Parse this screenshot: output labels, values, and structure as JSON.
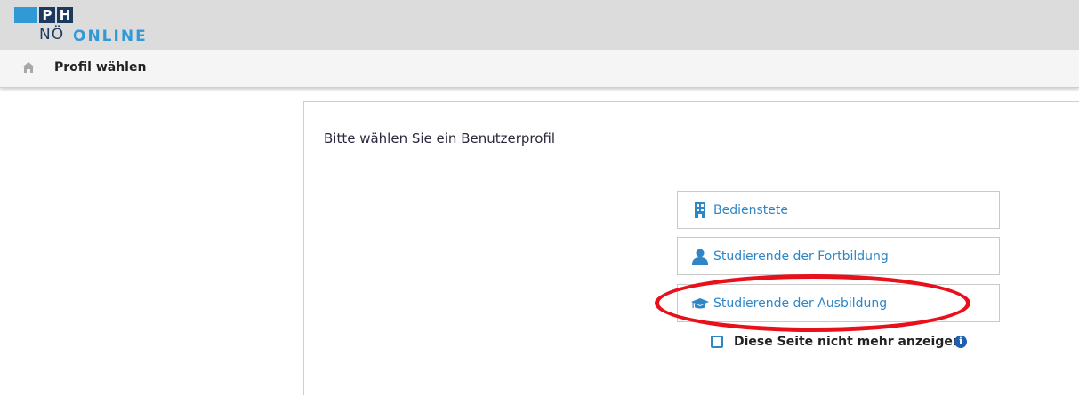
{
  "header": {
    "logo": {
      "letters_top": [
        "P",
        "H"
      ],
      "letters_bottom": "NÖ",
      "brand": "ONLINE"
    },
    "colors": {
      "brand_dark": "#1d3a5e",
      "brand_blue": "#2f9ad6"
    }
  },
  "breadcrumb": {
    "home_icon": "home-icon",
    "label": "Profil wählen"
  },
  "main": {
    "heading": "Bitte wählen Sie ein Benutzerprofil",
    "profiles": [
      {
        "label": "Bedienstete",
        "icon": "building-icon"
      },
      {
        "label": "Studierende der Fortbildung",
        "icon": "user-icon"
      },
      {
        "label": "Studierende der Ausbildung",
        "icon": "graduation-cap-icon"
      }
    ],
    "highlighted_profile": "Studierende der Ausbildung",
    "highlight_color": "#e8101b",
    "dont_show_again": {
      "label": "Diese Seite nicht mehr anzeigen.",
      "checked": false,
      "info_icon": "info-icon"
    },
    "link_color": "#2f86c7"
  }
}
